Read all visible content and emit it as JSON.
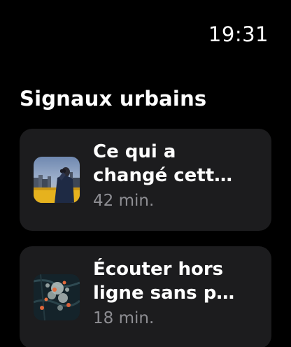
{
  "status": {
    "time": "19:31"
  },
  "section": {
    "title": "Signaux urbains"
  },
  "episodes": [
    {
      "title": "Ce qui a\nchangé cett…",
      "duration": "42 min.",
      "artwork": "person-binoculars-city-artwork"
    },
    {
      "title": "Écouter hors\nligne sans p…",
      "duration": "18 min.",
      "artwork": "dark-map-paint-splatter-artwork"
    }
  ]
}
